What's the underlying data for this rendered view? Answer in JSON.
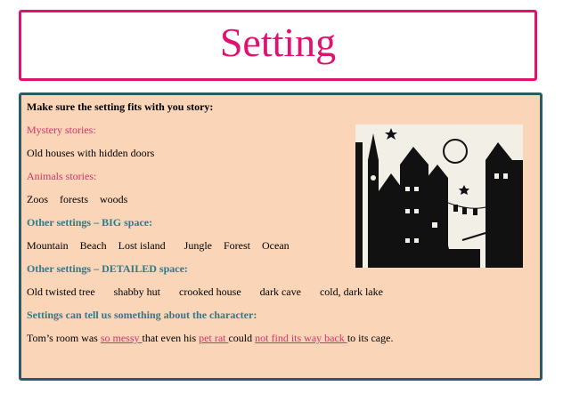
{
  "title": "Setting",
  "content": {
    "intro": "Make sure the setting fits with you story:",
    "mystery_heading": "Mystery stories:",
    "mystery_text": "Old houses with hidden doors",
    "animal_heading": "Animals stories:",
    "animal_items": [
      "Zoos",
      "forests",
      "woods"
    ],
    "big_heading": "Other settings – BIG space:",
    "big_items": [
      "Mountain",
      "Beach",
      "Lost island",
      "Jungle",
      "Forest",
      "Ocean"
    ],
    "detailed_heading": "Other settings – DETAILED space:",
    "detailed_items": [
      "Old twisted tree",
      "shabby hut",
      "crooked house",
      "dark cave",
      "cold, dark lake"
    ],
    "character_heading": "Settings can tell us something about the character:",
    "sentence": {
      "p1": "Tom’s room was ",
      "u1": "so messy ",
      "p2": "that even his ",
      "u2": "pet rat ",
      "p3": "could ",
      "u3": "not find its way back ",
      "p4": "to its cage."
    }
  },
  "colors": {
    "title": "#e0116f",
    "panel_border": "#2b5b64",
    "panel_bg": "#fad5b8",
    "pink_text": "#d6336c",
    "teal_text": "#2e7a8b"
  },
  "illustration_icon": "town-silhouette-icon"
}
